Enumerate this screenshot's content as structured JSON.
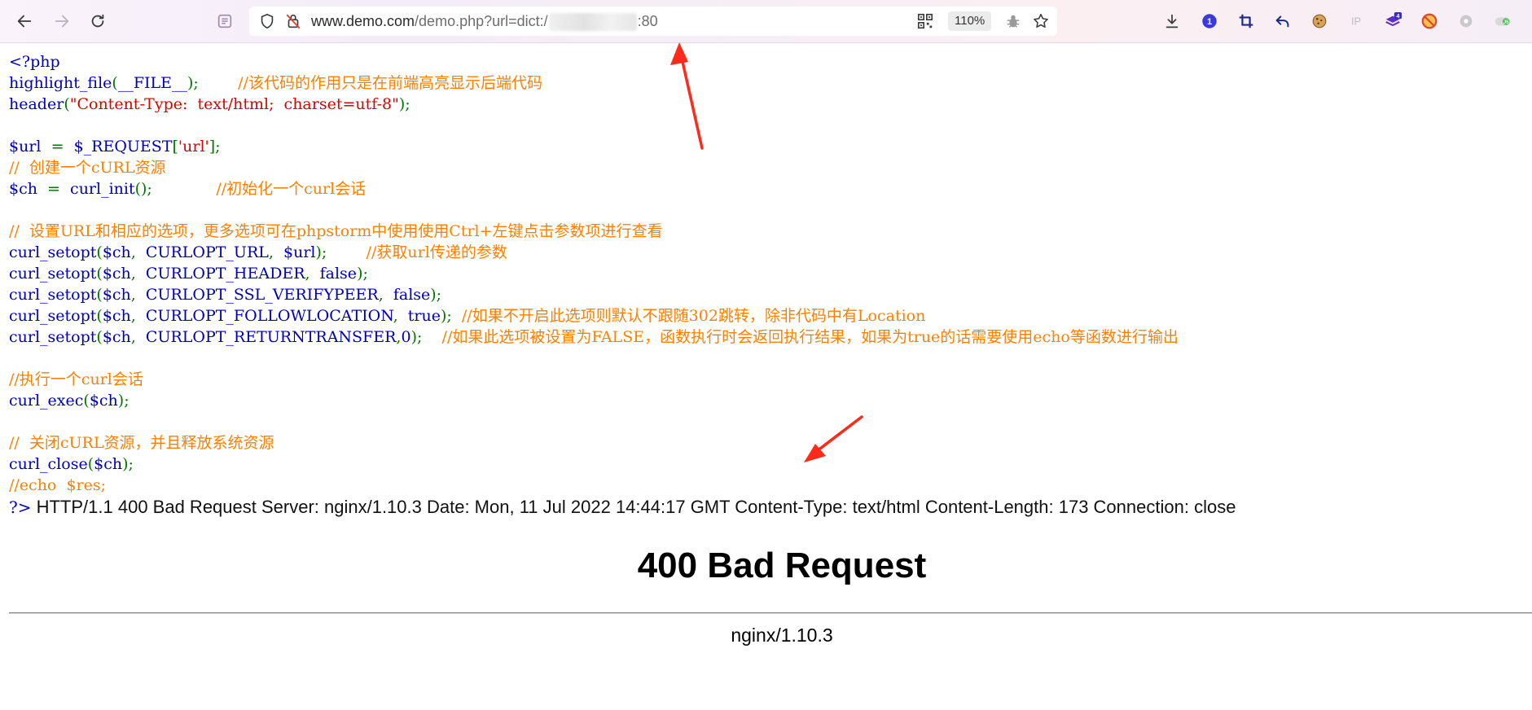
{
  "browser": {
    "url": {
      "host": "www.demo.com",
      "path": "/demo.php?url=dict:/",
      "port": ":80"
    },
    "zoom": "110%",
    "nav_icons": [
      "back-arrow-icon",
      "forward-arrow-icon",
      "reload-icon",
      "reader-mode-icon"
    ],
    "addressbar_icons": [
      "shield-icon",
      "tracking-protection-icon",
      "qr-code-icon",
      "bug-icon",
      "star-icon"
    ],
    "extension_icons": [
      "download-icon",
      "password-manager-icon",
      "crop-icon",
      "undo-icon",
      "cookie-icon",
      "ip-icon",
      "layers-icon",
      "block-icon",
      "gear-icon",
      "toggle-icon"
    ],
    "extension_badges": {
      "layers": "4",
      "toggle": "J5"
    },
    "accent_colors": {
      "password_manager": "#3b3ad6",
      "layers": "#5b2fc9",
      "block": "#e2452f",
      "arrow": "#ff2a1a"
    }
  },
  "code": [
    [
      {
        "t": "<?php",
        "c": "def"
      }
    ],
    [
      {
        "t": "highlight_file",
        "c": "def"
      },
      {
        "t": "(",
        "c": "kw"
      },
      {
        "t": "__FILE__",
        "c": "def"
      },
      {
        "t": ");        ",
        "c": "kw"
      },
      {
        "t": "//该代码的作用只是在前端高亮显示后端代码",
        "c": "cm"
      }
    ],
    [
      {
        "t": "header",
        "c": "def"
      },
      {
        "t": "(",
        "c": "kw"
      },
      {
        "t": "\"Content-Type:  text/html;  charset=utf-8\"",
        "c": "str"
      },
      {
        "t": ");",
        "c": "kw"
      }
    ],
    [],
    [
      {
        "t": "$url  ",
        "c": "def"
      },
      {
        "t": "=  ",
        "c": "kw"
      },
      {
        "t": "$_REQUEST",
        "c": "def"
      },
      {
        "t": "[",
        "c": "kw"
      },
      {
        "t": "'url'",
        "c": "str"
      },
      {
        "t": "];",
        "c": "kw"
      }
    ],
    [
      {
        "t": "//  创建一个cURL资源",
        "c": "cm"
      }
    ],
    [
      {
        "t": "$ch  ",
        "c": "def"
      },
      {
        "t": "=  ",
        "c": "kw"
      },
      {
        "t": "curl_init",
        "c": "def"
      },
      {
        "t": "();             ",
        "c": "kw"
      },
      {
        "t": "//初始化一个curl会话",
        "c": "cm"
      }
    ],
    [],
    [
      {
        "t": "//  设置URL和相应的选项，更多选项可在phpstorm中使用使用Ctrl+左键点击参数项进行查看",
        "c": "cm"
      }
    ],
    [
      {
        "t": "curl_setopt",
        "c": "def"
      },
      {
        "t": "(",
        "c": "kw"
      },
      {
        "t": "$ch",
        "c": "def"
      },
      {
        "t": ",  ",
        "c": "kw"
      },
      {
        "t": "CURLOPT_URL",
        "c": "def"
      },
      {
        "t": ",  ",
        "c": "kw"
      },
      {
        "t": "$url",
        "c": "def"
      },
      {
        "t": ");        ",
        "c": "kw"
      },
      {
        "t": "//获取url传递的参数",
        "c": "cm"
      }
    ],
    [
      {
        "t": "curl_setopt",
        "c": "def"
      },
      {
        "t": "(",
        "c": "kw"
      },
      {
        "t": "$ch",
        "c": "def"
      },
      {
        "t": ",  ",
        "c": "kw"
      },
      {
        "t": "CURLOPT_HEADER",
        "c": "def"
      },
      {
        "t": ",  ",
        "c": "kw"
      },
      {
        "t": "false",
        "c": "def"
      },
      {
        "t": ");",
        "c": "kw"
      }
    ],
    [
      {
        "t": "curl_setopt",
        "c": "def"
      },
      {
        "t": "(",
        "c": "kw"
      },
      {
        "t": "$ch",
        "c": "def"
      },
      {
        "t": ",  ",
        "c": "kw"
      },
      {
        "t": "CURLOPT_SSL_VERIFYPEER",
        "c": "def"
      },
      {
        "t": ",  ",
        "c": "kw"
      },
      {
        "t": "false",
        "c": "def"
      },
      {
        "t": ");",
        "c": "kw"
      }
    ],
    [
      {
        "t": "curl_setopt",
        "c": "def"
      },
      {
        "t": "(",
        "c": "kw"
      },
      {
        "t": "$ch",
        "c": "def"
      },
      {
        "t": ",  ",
        "c": "kw"
      },
      {
        "t": "CURLOPT_FOLLOWLOCATION",
        "c": "def"
      },
      {
        "t": ",  ",
        "c": "kw"
      },
      {
        "t": "true",
        "c": "def"
      },
      {
        "t": ");  ",
        "c": "kw"
      },
      {
        "t": "//如果不开启此选项则默认不跟随302跳转，除非代码中有Location",
        "c": "cm"
      }
    ],
    [
      {
        "t": "curl_setopt",
        "c": "def"
      },
      {
        "t": "(",
        "c": "kw"
      },
      {
        "t": "$ch",
        "c": "def"
      },
      {
        "t": ",  ",
        "c": "kw"
      },
      {
        "t": "CURLOPT_RETURNTRANSFER",
        "c": "def"
      },
      {
        "t": ",",
        "c": "kw"
      },
      {
        "t": "0",
        "c": "def"
      },
      {
        "t": ");    ",
        "c": "kw"
      },
      {
        "t": "//如果此选项被设置为FALSE，函数执行时会返回执行结果，如果为true的话需要使用echo等函数进行输出",
        "c": "cm"
      }
    ],
    [],
    [
      {
        "t": "//执行一个curl会话",
        "c": "cm"
      }
    ],
    [
      {
        "t": "curl_exec",
        "c": "def"
      },
      {
        "t": "(",
        "c": "kw"
      },
      {
        "t": "$ch",
        "c": "def"
      },
      {
        "t": ");",
        "c": "kw"
      }
    ],
    [],
    [
      {
        "t": "//  关闭cURL资源，并且释放系统资源",
        "c": "cm"
      }
    ],
    [
      {
        "t": "curl_close",
        "c": "def"
      },
      {
        "t": "(",
        "c": "kw"
      },
      {
        "t": "$ch",
        "c": "def"
      },
      {
        "t": ");",
        "c": "kw"
      }
    ],
    [
      {
        "t": "//echo  $res;",
        "c": "cm"
      }
    ]
  ],
  "response": {
    "php_close": "?>",
    "text": "HTTP/1.1 400 Bad Request Server: nginx/1.10.3 Date: Mon, 11 Jul 2022 14:44:17 GMT Content-Type: text/html Content-Length: 173 Connection: close"
  },
  "error_page": {
    "title": "400 Bad Request",
    "footer": "nginx/1.10.3"
  }
}
